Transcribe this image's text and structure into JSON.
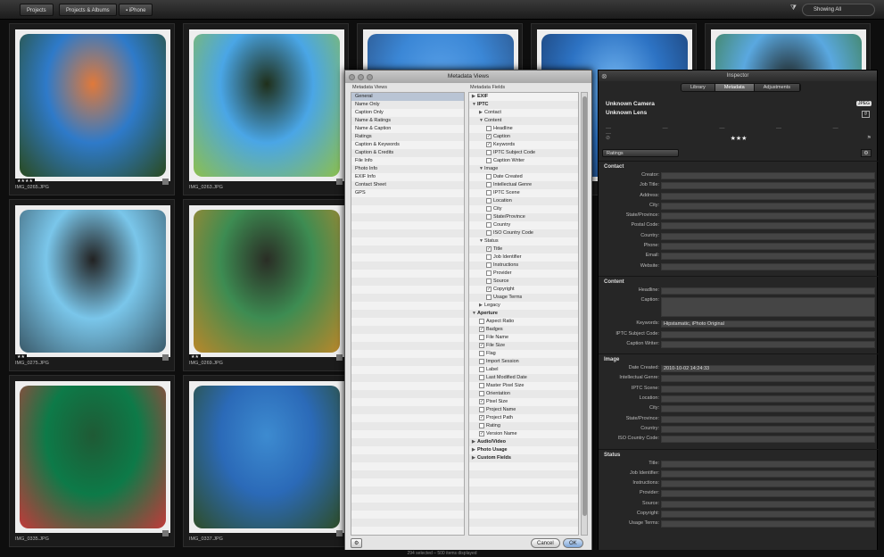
{
  "topbar": {
    "tab_projects": "Projects",
    "tab_projects_albums": "Projects & Albums",
    "tab_iphone": "iPhone",
    "filter": "Showing All"
  },
  "photos": [
    {
      "name": "IMG_0265.JPG",
      "rating": "★★★★",
      "colors": [
        "#2e7ac9",
        "#e0793a",
        "#2a4a1f"
      ]
    },
    {
      "name": "IMG_0263.JPG",
      "rating": "",
      "colors": [
        "#4aa6e6",
        "#1f2f1a",
        "#8cbf4d"
      ]
    },
    {
      "name": "",
      "rating": "",
      "colors": [
        "#3b87d6",
        "#5aa1e8",
        "#2a4e80"
      ]
    },
    {
      "name": "",
      "rating": "",
      "colors": [
        "#2d73c4",
        "#6fb2ee",
        "#1a3a6a"
      ]
    },
    {
      "name": "",
      "rating": "",
      "colors": [
        "#5aa8e0",
        "#1c1f1c",
        "#3b7a3a"
      ]
    },
    {
      "name": "IMG_0275.JPG",
      "rating": "★★",
      "colors": [
        "#7ac6ea",
        "#222",
        "#3a5a6a"
      ]
    },
    {
      "name": "IMG_0269.JPG",
      "rating": "★★",
      "colors": [
        "#3d8c52",
        "#2a2d25",
        "#b9872a"
      ]
    },
    {
      "name": "IMG_0335.JPG",
      "rating": "",
      "colors": [
        "#0d7a48",
        "#1f5a35",
        "#c23a3a"
      ]
    },
    {
      "name": "IMG_0337.JPG",
      "rating": "",
      "colors": [
        "#2b6ab8",
        "#3d8bd0",
        "#2e4d28"
      ]
    }
  ],
  "metadata_views": {
    "title": "Metadata Views",
    "views_header": "Metadata Views",
    "fields_header": "Metadata Fields",
    "views": [
      "General",
      "Name Only",
      "Caption Only",
      "Name & Ratings",
      "Name & Caption",
      "Ratings",
      "Caption & Keywords",
      "Caption & Credits",
      "File Info",
      "Photo Info",
      "EXIF Info",
      "Contact Sheet",
      "GPS"
    ],
    "fields": [
      {
        "t": "EXIF",
        "lvl": 0,
        "tri": "▶",
        "bold": true
      },
      {
        "t": "IPTC",
        "lvl": 0,
        "tri": "▼",
        "bold": true
      },
      {
        "t": "Contact",
        "lvl": 1,
        "tri": "▶"
      },
      {
        "t": "Content",
        "lvl": 1,
        "tri": "▼"
      },
      {
        "t": "Headline",
        "lvl": 2,
        "cb": ""
      },
      {
        "t": "Caption",
        "lvl": 2,
        "cb": "✓"
      },
      {
        "t": "Keywords",
        "lvl": 2,
        "cb": "✓"
      },
      {
        "t": "IPTC Subject Code",
        "lvl": 2,
        "cb": ""
      },
      {
        "t": "Caption Writer",
        "lvl": 2,
        "cb": ""
      },
      {
        "t": "Image",
        "lvl": 1,
        "tri": "▼"
      },
      {
        "t": "Date Created",
        "lvl": 2,
        "cb": ""
      },
      {
        "t": "Intellectual Genre",
        "lvl": 2,
        "cb": ""
      },
      {
        "t": "IPTC Scene",
        "lvl": 2,
        "cb": ""
      },
      {
        "t": "Location",
        "lvl": 2,
        "cb": ""
      },
      {
        "t": "City",
        "lvl": 2,
        "cb": ""
      },
      {
        "t": "State/Province",
        "lvl": 2,
        "cb": ""
      },
      {
        "t": "Country",
        "lvl": 2,
        "cb": ""
      },
      {
        "t": "ISO Country Code",
        "lvl": 2,
        "cb": ""
      },
      {
        "t": "Status",
        "lvl": 1,
        "tri": "▼"
      },
      {
        "t": "Title",
        "lvl": 2,
        "cb": "✓"
      },
      {
        "t": "Job Identifier",
        "lvl": 2,
        "cb": ""
      },
      {
        "t": "Instructions",
        "lvl": 2,
        "cb": ""
      },
      {
        "t": "Provider",
        "lvl": 2,
        "cb": ""
      },
      {
        "t": "Source",
        "lvl": 2,
        "cb": ""
      },
      {
        "t": "Copyright",
        "lvl": 2,
        "cb": "✓"
      },
      {
        "t": "Usage Terms",
        "lvl": 2,
        "cb": ""
      },
      {
        "t": "Legacy",
        "lvl": 1,
        "tri": "▶"
      },
      {
        "t": "Aperture",
        "lvl": 0,
        "tri": "▼",
        "bold": true
      },
      {
        "t": "Aspect Ratio",
        "lvl": 1,
        "cb": ""
      },
      {
        "t": "Badges",
        "lvl": 1,
        "cb": "✓"
      },
      {
        "t": "File Name",
        "lvl": 1,
        "cb": ""
      },
      {
        "t": "File Size",
        "lvl": 1,
        "cb": "✓"
      },
      {
        "t": "Flag",
        "lvl": 1,
        "cb": ""
      },
      {
        "t": "Import Session",
        "lvl": 1,
        "cb": ""
      },
      {
        "t": "Label",
        "lvl": 1,
        "cb": ""
      },
      {
        "t": "Last Modified Date",
        "lvl": 1,
        "cb": ""
      },
      {
        "t": "Master Pixel Size",
        "lvl": 1,
        "cb": ""
      },
      {
        "t": "Orientation",
        "lvl": 1,
        "cb": ""
      },
      {
        "t": "Pixel Size",
        "lvl": 1,
        "cb": "✓"
      },
      {
        "t": "Project Name",
        "lvl": 1,
        "cb": ""
      },
      {
        "t": "Project Path",
        "lvl": 1,
        "cb": "✓"
      },
      {
        "t": "Rating",
        "lvl": 1,
        "cb": ""
      },
      {
        "t": "Version Name",
        "lvl": 1,
        "cb": "✓"
      },
      {
        "t": "Audio/Video",
        "lvl": 0,
        "tri": "▶",
        "bold": true
      },
      {
        "t": "Photo Usage",
        "lvl": 0,
        "tri": "▶",
        "bold": true
      },
      {
        "t": "Custom Fields",
        "lvl": 0,
        "tri": "▶",
        "bold": true
      }
    ],
    "cancel": "Cancel",
    "ok": "OK"
  },
  "inspector": {
    "title": "Inspector",
    "tabs": [
      "Library",
      "Metadata",
      "Adjustments"
    ],
    "camera": "Unknown Camera",
    "lens": "Unknown Lens",
    "format": "JPEG",
    "fnum": "f/",
    "dashes": "— — — — — —",
    "rating": "★★★",
    "popup": "Ratings",
    "sections": [
      {
        "head": "Contact",
        "fields": [
          {
            "l": "Creator:",
            "v": ""
          },
          {
            "l": "Job Title:",
            "v": ""
          },
          {
            "l": "Address:",
            "v": ""
          },
          {
            "l": "City:",
            "v": ""
          },
          {
            "l": "State/Province:",
            "v": ""
          },
          {
            "l": "Postal Code:",
            "v": ""
          },
          {
            "l": "Country:",
            "v": ""
          },
          {
            "l": "Phone:",
            "v": ""
          },
          {
            "l": "Email:",
            "v": ""
          },
          {
            "l": "Website:",
            "v": ""
          }
        ]
      },
      {
        "head": "Content",
        "fields": [
          {
            "l": "Headline:",
            "v": ""
          },
          {
            "l": "Caption:",
            "v": "",
            "tall": true
          },
          {
            "l": "Keywords:",
            "v": "Hipstamatic, iPhoto Original"
          },
          {
            "l": "IPTC Subject Code:",
            "v": ""
          },
          {
            "l": "Caption Writer:",
            "v": ""
          }
        ]
      },
      {
        "head": "Image",
        "fields": [
          {
            "l": "Date Created:",
            "v": "2010-10-02 14:24:33"
          },
          {
            "l": "Intellectual Genre:",
            "v": ""
          },
          {
            "l": "IPTC Scene:",
            "v": ""
          },
          {
            "l": "Location:",
            "v": ""
          },
          {
            "l": "City:",
            "v": ""
          },
          {
            "l": "State/Province:",
            "v": ""
          },
          {
            "l": "Country:",
            "v": ""
          },
          {
            "l": "ISO Country Code:",
            "v": ""
          }
        ]
      },
      {
        "head": "Status",
        "fields": [
          {
            "l": "Title:",
            "v": ""
          },
          {
            "l": "Job Identifier:",
            "v": ""
          },
          {
            "l": "Instructions:",
            "v": ""
          },
          {
            "l": "Provider:",
            "v": ""
          },
          {
            "l": "Source:",
            "v": ""
          },
          {
            "l": "Copyright:",
            "v": ""
          },
          {
            "l": "Usage Terms:",
            "v": ""
          }
        ]
      }
    ]
  },
  "status": "294 selected – 500 items displayed"
}
